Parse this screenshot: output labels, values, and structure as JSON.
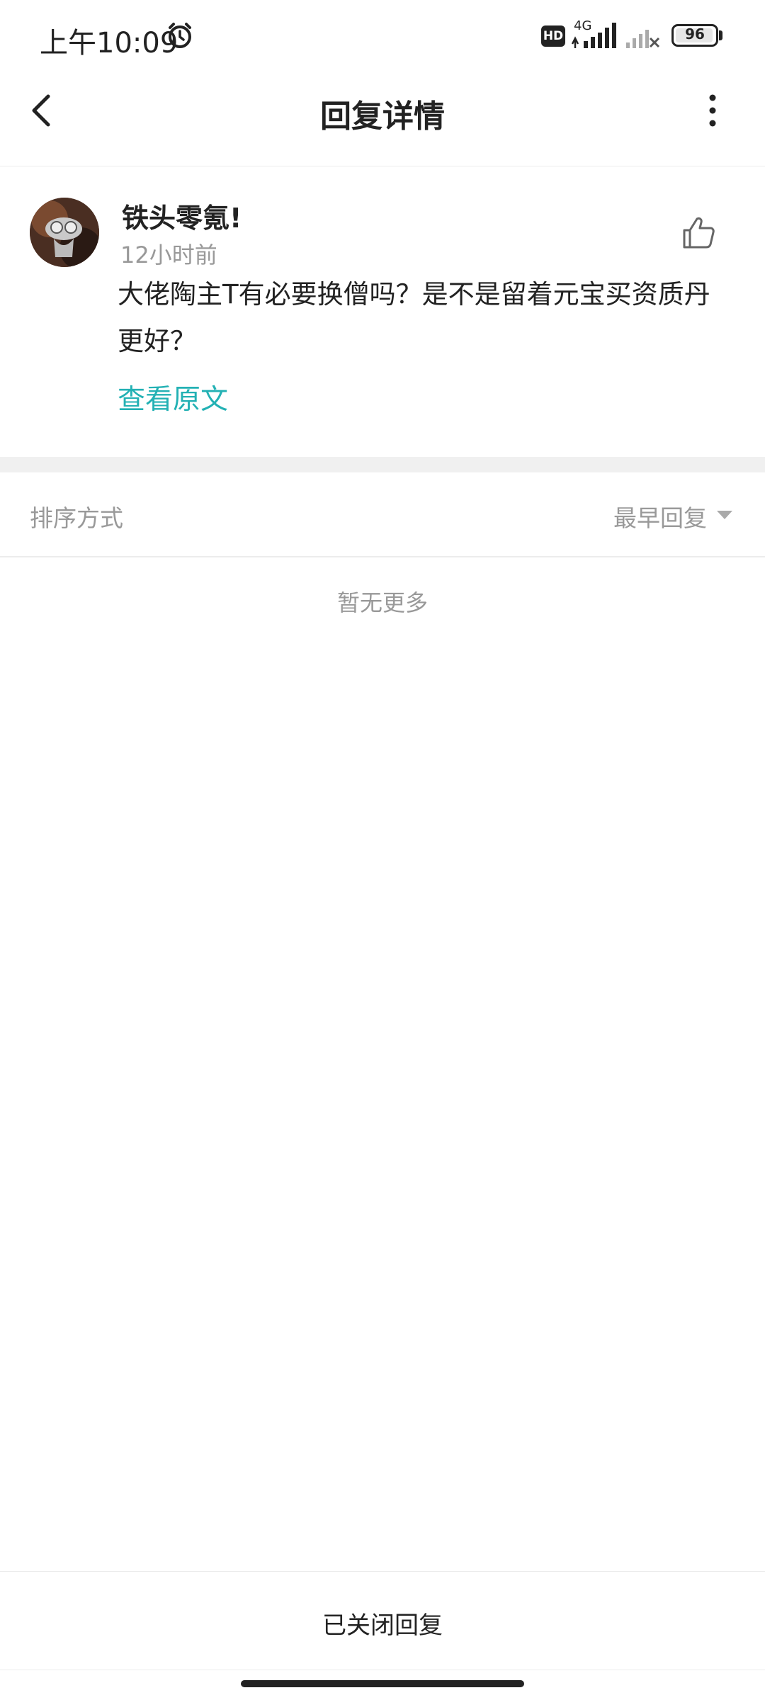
{
  "status_bar": {
    "time": "上午10:09",
    "hd_label": "HD",
    "network_label": "4G",
    "battery_level": "96",
    "battery_percent": 96,
    "icons": [
      "alarm-icon",
      "signal-icon",
      "no-signal-icon",
      "battery-icon"
    ]
  },
  "nav": {
    "title": "回复详情",
    "icons": [
      "back-icon",
      "more-icon"
    ]
  },
  "post": {
    "username": "铁头零氪!",
    "timestamp": "12小时前",
    "content": "大佬陶主T有必要换僧吗？是不是留着元宝买资质丹更好？",
    "view_original": "查看原文",
    "accent_color": "#23b1b4",
    "icons": [
      "avatar",
      "thumbs-up-icon"
    ]
  },
  "sort": {
    "label": "排序方式",
    "value": "最早回复"
  },
  "empty_text": "暂无更多",
  "bottom": {
    "label": "已关闭回复"
  }
}
